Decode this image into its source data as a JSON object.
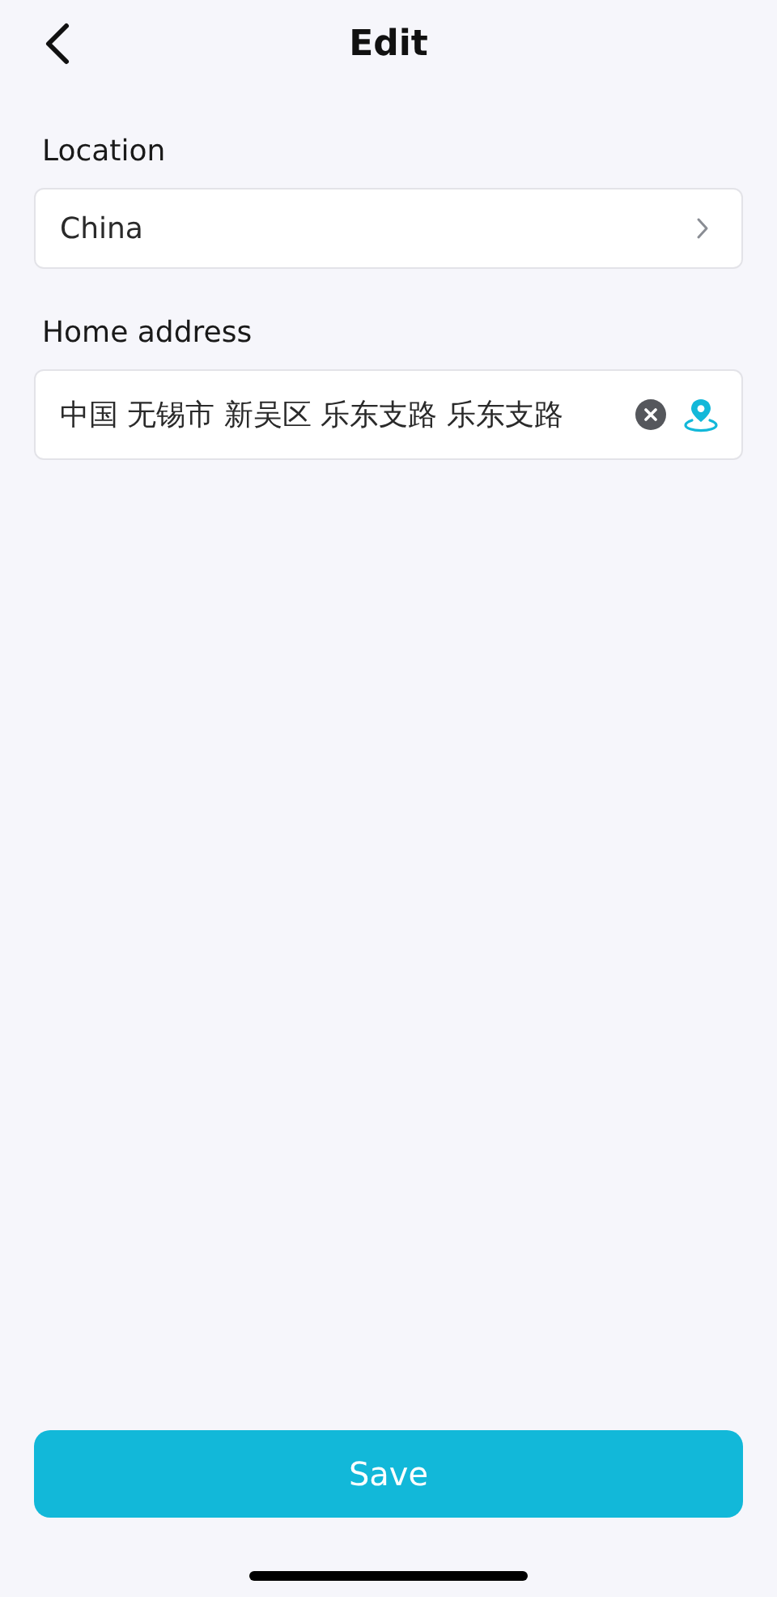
{
  "header": {
    "title": "Edit"
  },
  "fields": [
    {
      "kind": "select",
      "label": "Location",
      "value": "China"
    },
    {
      "kind": "address",
      "label": "Home address",
      "value": "中国 无锡市 新吴区 乐东支路 乐东支路"
    }
  ],
  "save_button": {
    "label": "Save"
  }
}
